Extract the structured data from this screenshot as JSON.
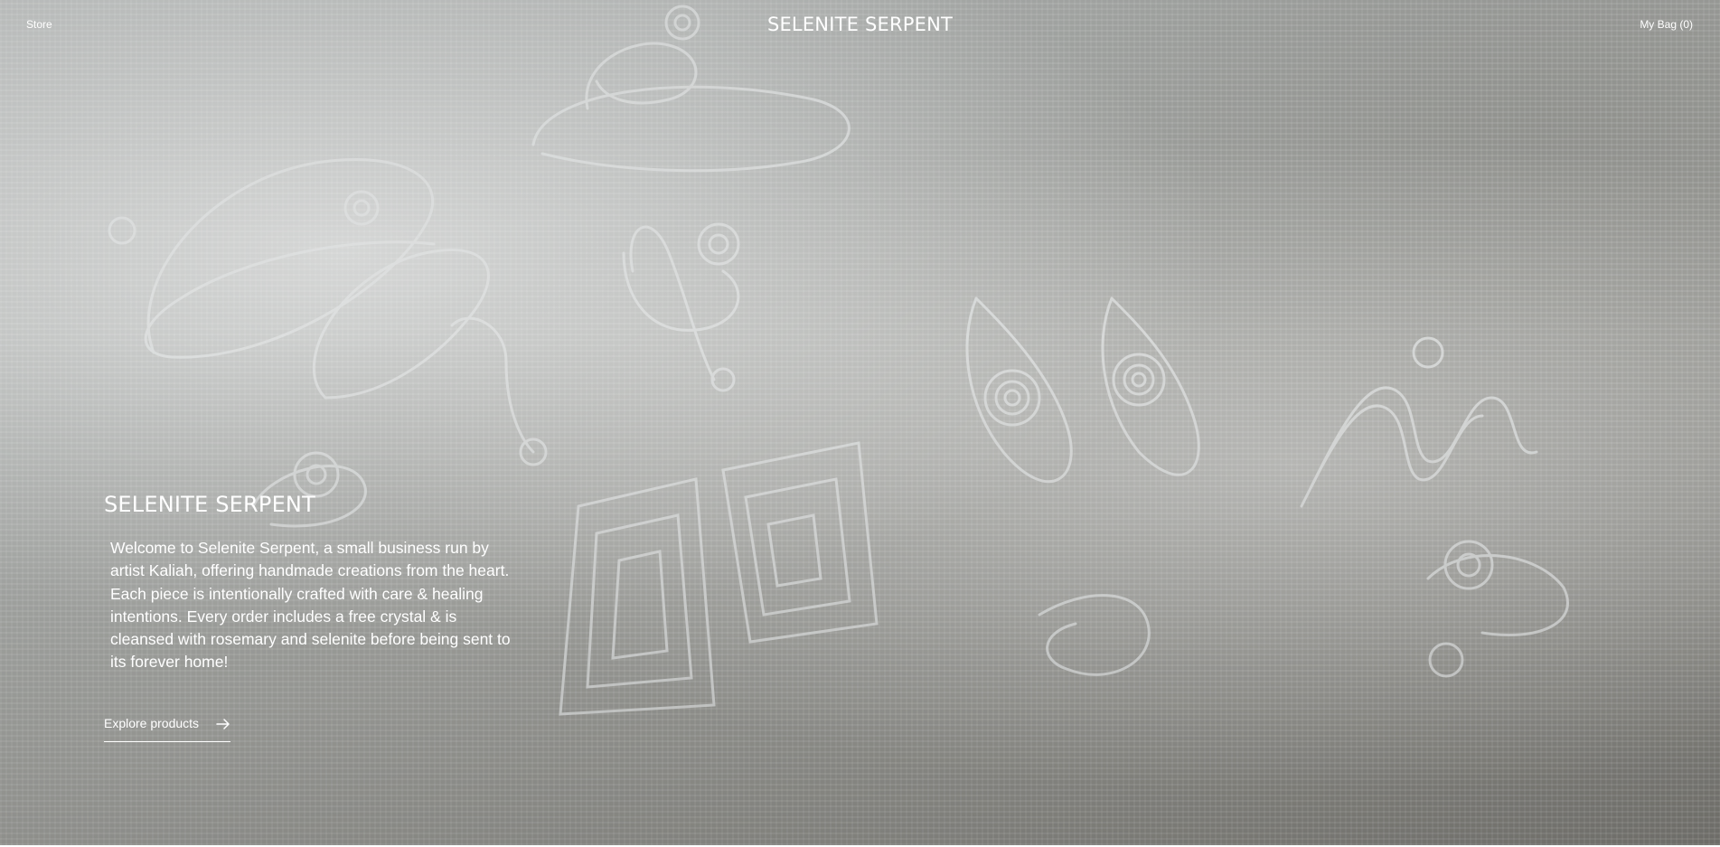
{
  "header": {
    "store_label": "Store",
    "brand": "SELENITE SERPENT",
    "bag_label": "My Bag (0)"
  },
  "hero": {
    "title": "SELENITE SERPENT",
    "description": "Welcome to Selenite Serpent, a small business run by artist Kaliah, offering handmade creations from the heart. Each piece is intentionally crafted with care & healing intentions. Every order includes a free crystal & is cleansed with rosemary and selenite before being sent to its forever home!",
    "cta_label": "Explore products",
    "cta_icon": "arrow-right-icon",
    "background_image": "silver-wire-jewelry-on-lace"
  },
  "colors": {
    "text": "#ffffff",
    "background_tone": "#a9aba8"
  }
}
